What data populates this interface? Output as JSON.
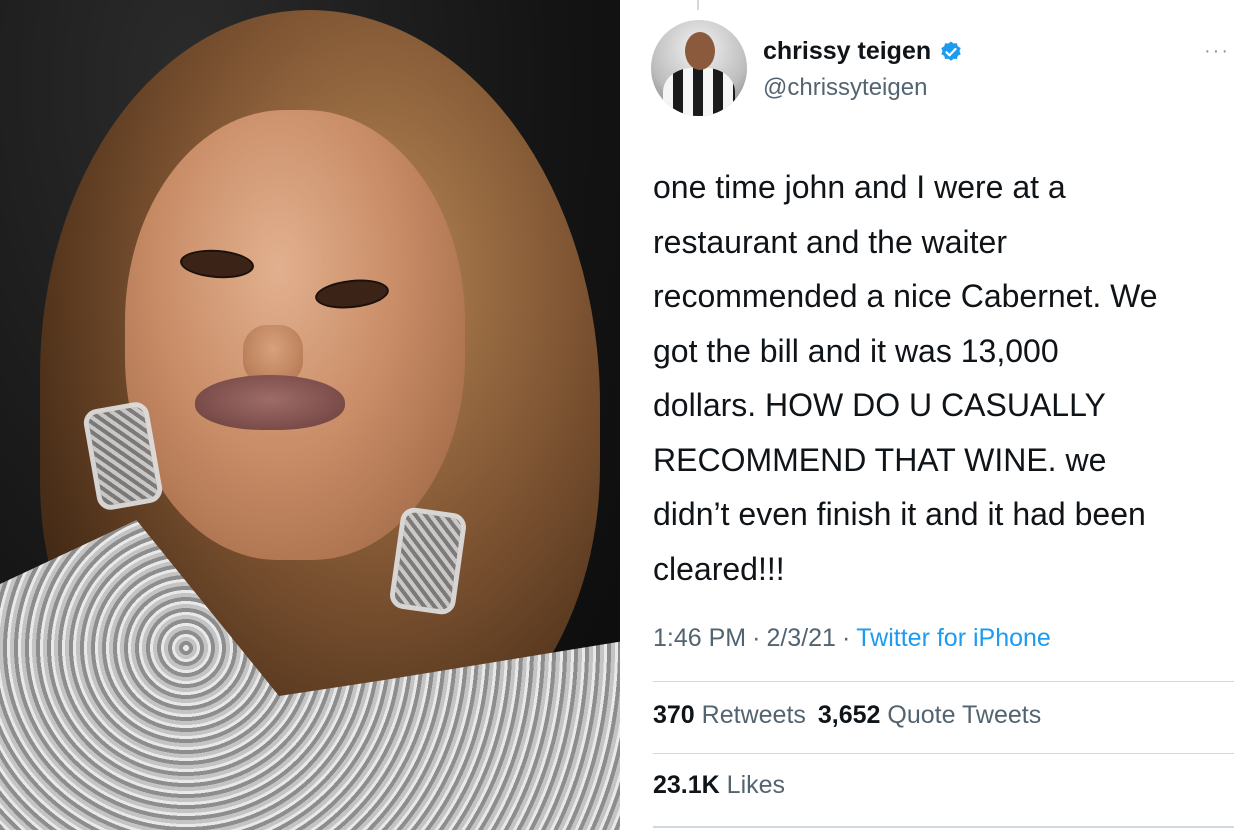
{
  "tweet": {
    "name": "chrissy teigen",
    "handle": "@chrissyteigen",
    "lines": [
      "one time john and I were at a",
      "restaurant and the waiter",
      "recommended a nice Cabernet. We",
      "got the bill and it was 13,000",
      "dollars. HOW DO U CASUALLY",
      "RECOMMEND THAT WINE. we",
      "didn’t even finish it and it had been",
      "cleared!!!"
    ],
    "time": "1:46 PM",
    "date": "2/3/21",
    "source": "Twitter for iPhone",
    "separator": "·",
    "retweets_count": "370",
    "retweets_label": "Retweets",
    "quotes_count": "3,652",
    "quotes_label": "Quote Tweets",
    "likes_count": "23.1K",
    "likes_label": "Likes",
    "more": "···"
  },
  "colors": {
    "text": "#0f1419",
    "muted": "#536471",
    "link": "#1d9bf0",
    "verified": "#1d9bf0",
    "divider": "#cfd9de"
  },
  "icons": {
    "verified": "verified-badge-icon",
    "more": "more-options-icon"
  }
}
